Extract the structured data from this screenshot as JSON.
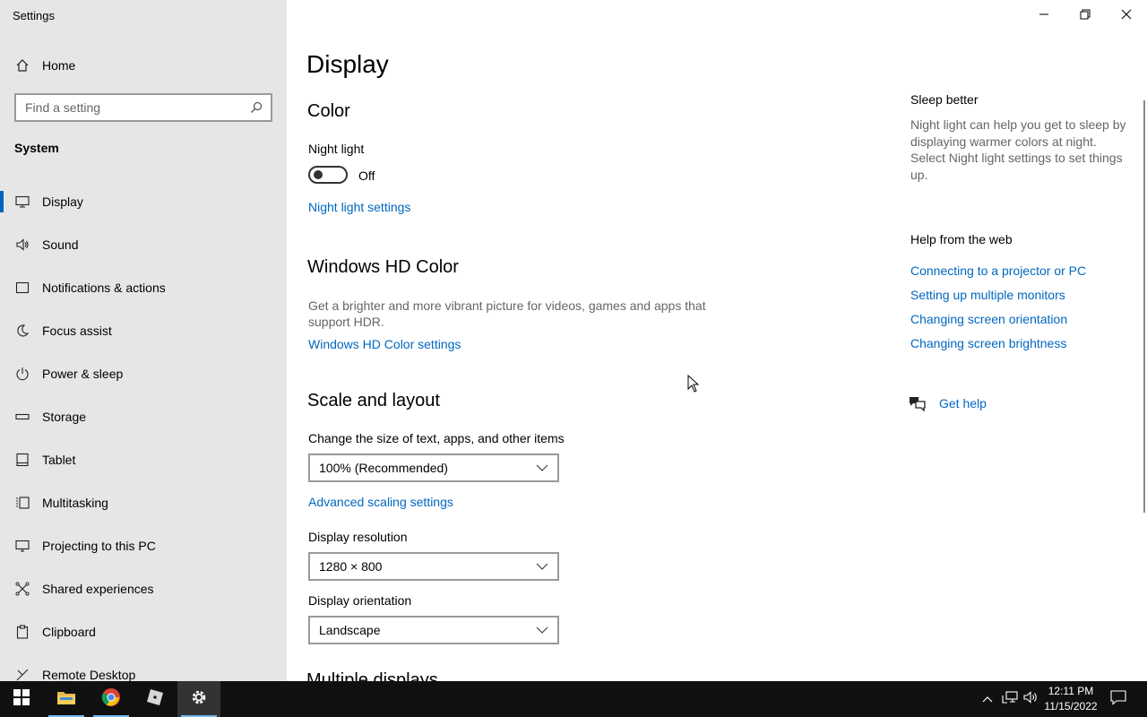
{
  "app": {
    "title": "Settings"
  },
  "sidebar": {
    "home_label": "Home",
    "search_placeholder": "Find a setting",
    "section": "System",
    "items": [
      {
        "label": "Display",
        "icon": "monitor-icon",
        "active": true
      },
      {
        "label": "Sound",
        "icon": "speaker-icon"
      },
      {
        "label": "Notifications & actions",
        "icon": "notification-icon"
      },
      {
        "label": "Focus assist",
        "icon": "moon-icon"
      },
      {
        "label": "Power & sleep",
        "icon": "power-icon"
      },
      {
        "label": "Storage",
        "icon": "storage-icon"
      },
      {
        "label": "Tablet",
        "icon": "tablet-icon"
      },
      {
        "label": "Multitasking",
        "icon": "multitasking-icon"
      },
      {
        "label": "Projecting to this PC",
        "icon": "projecting-icon"
      },
      {
        "label": "Shared experiences",
        "icon": "shared-icon"
      },
      {
        "label": "Clipboard",
        "icon": "clipboard-icon"
      },
      {
        "label": "Remote Desktop",
        "icon": "remote-desktop-icon"
      }
    ]
  },
  "main": {
    "title": "Display",
    "color": {
      "heading": "Color",
      "night_light_label": "Night light",
      "night_light_state": "Off",
      "night_light_settings_link": "Night light settings"
    },
    "hdr": {
      "heading": "Windows HD Color",
      "description": "Get a brighter and more vibrant picture for videos, games and apps that support HDR.",
      "settings_link": "Windows HD Color settings"
    },
    "scale": {
      "heading": "Scale and layout",
      "size_label": "Change the size of text, apps, and other items",
      "size_value": "100% (Recommended)",
      "advanced_link": "Advanced scaling settings",
      "resolution_label": "Display resolution",
      "resolution_value": "1280 × 800",
      "orientation_label": "Display orientation",
      "orientation_value": "Landscape"
    },
    "next_heading_partial": "Multiple displays"
  },
  "right": {
    "sleep_heading": "Sleep better",
    "sleep_text": "Night light can help you get to sleep by displaying warmer colors at night. Select Night light settings to set things up.",
    "help_heading": "Help from the web",
    "help_links": [
      "Connecting to a projector or PC",
      "Setting up multiple monitors",
      "Changing screen orientation",
      "Changing screen brightness"
    ],
    "get_help": "Get help"
  },
  "taskbar": {
    "time": "12:11 PM",
    "date": "11/15/2022",
    "apps": [
      "start-icon",
      "file-explorer-icon",
      "chrome-icon",
      "roblox-icon",
      "settings-gear-icon"
    ]
  },
  "colors": {
    "accent": "#0067c0",
    "sidebar_bg": "#e6e6e6",
    "taskbar_bg": "#101010"
  }
}
